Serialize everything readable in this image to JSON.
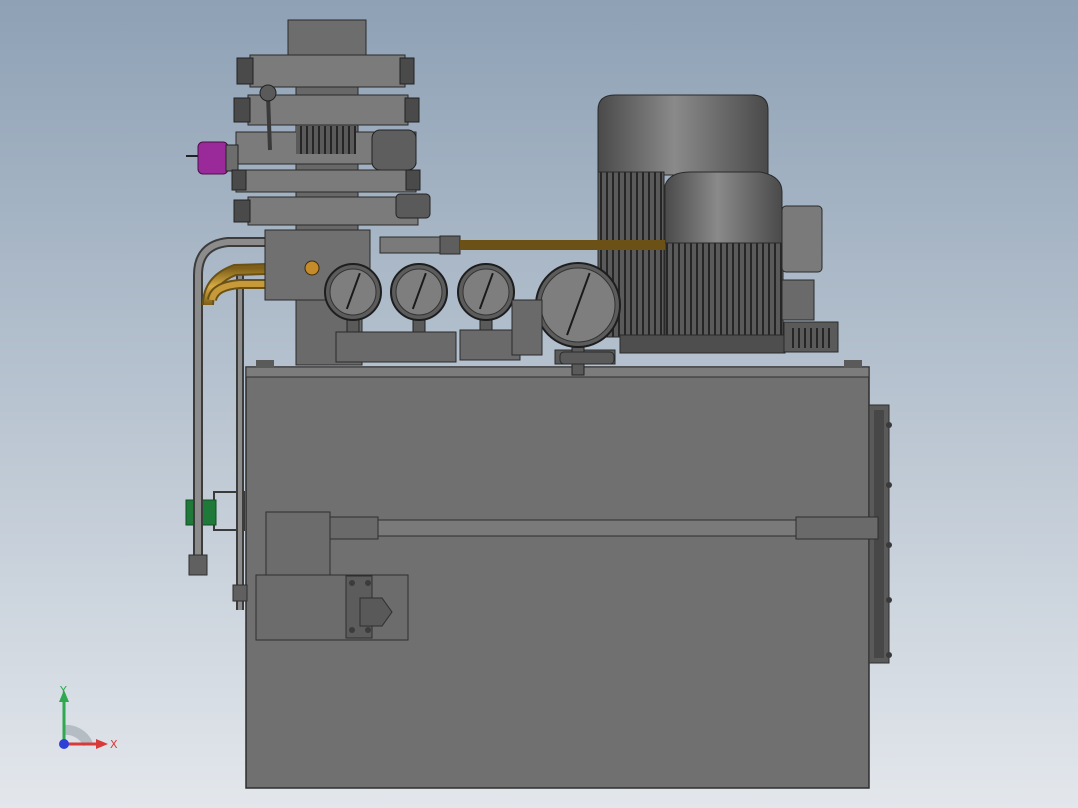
{
  "scene": {
    "background_top": "#8da0b4",
    "background_bottom": "#dfe4ea",
    "metal": "#6f6f6f",
    "metal_dark": "#3c3c3c",
    "metal_light": "#9a9a9a",
    "brass": "#b08a2e",
    "accent_green": "#1f7a3a",
    "accent_magenta": "#9a2a9a"
  },
  "axis_triad": {
    "x_label": "X",
    "y_label": "Y",
    "x_color": "#d83a3a",
    "y_color": "#2fa84f",
    "z_color": "#2d3fd6"
  },
  "gauges": [
    {
      "name": "gauge-1",
      "needle_deg": 20
    },
    {
      "name": "gauge-2",
      "needle_deg": 20
    },
    {
      "name": "gauge-3",
      "needle_deg": 20
    },
    {
      "name": "gauge-4",
      "needle_deg": 20
    }
  ]
}
